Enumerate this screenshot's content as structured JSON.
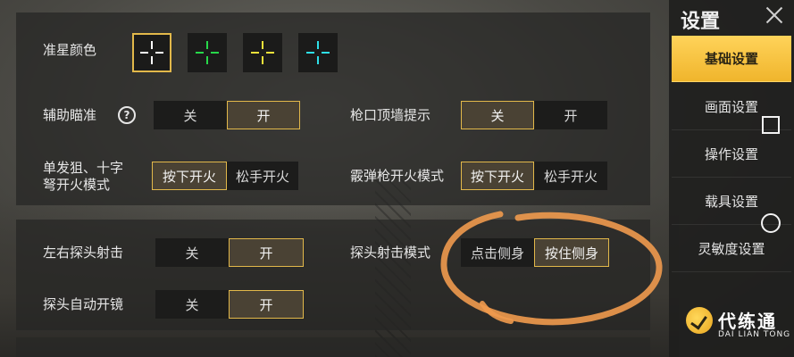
{
  "sidebar": {
    "title": "设置",
    "items": [
      {
        "label": "基础设置",
        "active": true
      },
      {
        "label": "画面设置",
        "active": false
      },
      {
        "label": "操作设置",
        "active": false
      },
      {
        "label": "载具设置",
        "active": false
      },
      {
        "label": "灵敏度设置",
        "active": false
      }
    ]
  },
  "settings": {
    "crosshair_color": {
      "label": "准星颜色",
      "options": [
        {
          "color": "#ffffff",
          "selected": true
        },
        {
          "color": "#27d84a",
          "selected": false
        },
        {
          "color": "#f2e23a",
          "selected": false
        },
        {
          "color": "#2ee0e8",
          "selected": false
        }
      ]
    },
    "aim_assist": {
      "label": "辅助瞄准",
      "options": [
        "关",
        "开"
      ],
      "selected": "开"
    },
    "muzzle_wall_hint": {
      "label": "枪口顶墙提示",
      "options": [
        "关",
        "开"
      ],
      "selected": "关"
    },
    "single_fire_mode": {
      "label_line1": "单发狙、十字",
      "label_line2": "弩开火模式",
      "options": [
        "按下开火",
        "松手开火"
      ],
      "selected": "按下开火"
    },
    "shotgun_fire_mode": {
      "label": "霰弹枪开火模式",
      "options": [
        "按下开火",
        "松手开火"
      ],
      "selected": "按下开火"
    },
    "peek_fire": {
      "label": "左右探头射击",
      "options": [
        "关",
        "开"
      ],
      "selected": "开"
    },
    "peek_fire_mode": {
      "label": "探头射击模式",
      "options": [
        "点击侧身",
        "按住侧身"
      ],
      "selected": "按住侧身"
    },
    "peek_auto_scope": {
      "label": "探头自动开镜",
      "options": [
        "关",
        "开"
      ],
      "selected": "开"
    }
  },
  "watermark": {
    "name": "代练通",
    "subtitle": "DAI LIAN TONG"
  },
  "colors": {
    "accent": "#e2b84a",
    "annotation": "#f09a4e"
  }
}
